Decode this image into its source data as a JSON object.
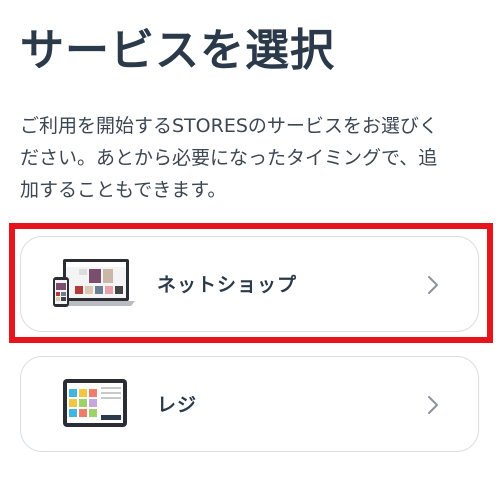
{
  "header": {
    "title": "サービスを選択"
  },
  "intro": {
    "lines": [
      "ご利用を開始するSTORESのサービスをお選びく",
      "ださい。あとから必要になったタイミングで、追",
      "加することもできます。"
    ]
  },
  "services": [
    {
      "label": "ネットショップ",
      "icon": "netshop-devices-icon",
      "selected": true
    },
    {
      "label": "レジ",
      "icon": "pos-tablet-icon",
      "selected": false
    }
  ],
  "colors": {
    "text": "#2b3a4a",
    "card_border": "#d9dde2",
    "highlight": "#e8141b"
  }
}
